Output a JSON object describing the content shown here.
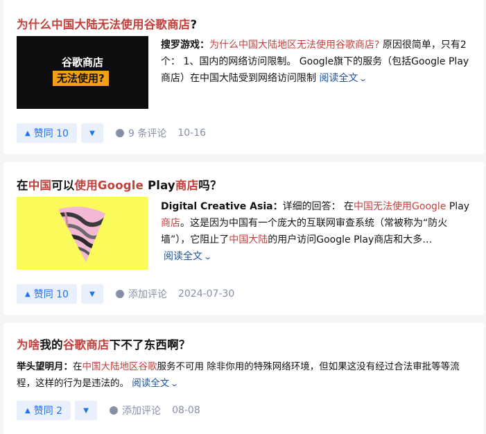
{
  "results": [
    {
      "title_parts": [
        {
          "text": "为什么中国大陆无法使用谷歌商店",
          "hl": true
        },
        {
          "text": "?",
          "hl": false
        }
      ],
      "thumb": {
        "line1": "谷歌商店",
        "line2": "无法使用?",
        "bg": "#0d0d0d",
        "accent": "#f5a013"
      },
      "author": "搜罗游戏",
      "excerpt_parts": [
        {
          "text": "为什么中国大陆地区无法使用谷歌商店?",
          "hl": true
        },
        {
          "text": " 原因很简单，只有2个： 1、国内的网络访问限制。 Google旗下的服务（包括Google Play商店）在中国大陆受到网络访问限制 ",
          "hl": false
        }
      ],
      "read_more": "阅读全文",
      "upvote_label": "赞同 10",
      "comment_label": "9 条评论",
      "date": "10-16"
    },
    {
      "title_parts": [
        {
          "text": "在",
          "hl": false
        },
        {
          "text": "中国",
          "hl": true
        },
        {
          "text": "可以",
          "hl": false
        },
        {
          "text": "使用Google",
          "hl": true
        },
        {
          "text": " Play",
          "hl": false
        },
        {
          "text": "商店",
          "hl": true
        },
        {
          "text": "吗？",
          "hl": false
        }
      ],
      "thumb": {
        "bg": "#fafa5a",
        "accent": "#f2b8d4"
      },
      "author": "Digital Creative Asia",
      "excerpt_parts": [
        {
          "text": "详细的回答： 在",
          "hl": false
        },
        {
          "text": "中国无法使用Google",
          "hl": true
        },
        {
          "text": " Play",
          "hl": false
        },
        {
          "text": "商店",
          "hl": true
        },
        {
          "text": "。这是因为中国有一个庞大的互联网审查系统（常被称为“防火墙”），它阻止了",
          "hl": false
        },
        {
          "text": "中国大陆",
          "hl": true
        },
        {
          "text": "的用户访问Google Play商店和大多…",
          "hl": false
        }
      ],
      "read_more": "阅读全文",
      "upvote_label": "赞同 10",
      "comment_label": "添加评论",
      "date": "2024-07-30"
    },
    {
      "title_parts": [
        {
          "text": "为啥",
          "hl": true
        },
        {
          "text": "我的",
          "hl": false
        },
        {
          "text": "谷歌商店",
          "hl": true
        },
        {
          "text": "下不了东西啊？",
          "hl": false
        }
      ],
      "author": "举头望明月",
      "excerpt_parts": [
        {
          "text": "在",
          "hl": false
        },
        {
          "text": "中国大陆地区谷歌",
          "hl": true
        },
        {
          "text": "服务不可用 除非你用的特殊网络环境，但如果这没有经过合法审批等等流程，这样的行为是违法的。 ",
          "hl": false
        }
      ],
      "read_more": "阅读全文",
      "upvote_label": "赞同 2",
      "comment_label": "添加评论",
      "date": "08-08"
    }
  ],
  "colors": {
    "highlight": "#c2413d",
    "link": "#175199",
    "vote": "#1772f6",
    "vote_bg": "#e9f0fb",
    "meta": "#8590a6"
  },
  "icons": {
    "upvote": "triangle-up-icon",
    "downvote": "triangle-down-icon",
    "comment": "comment-bubble-icon",
    "read_more": "chevron-down-icon"
  }
}
